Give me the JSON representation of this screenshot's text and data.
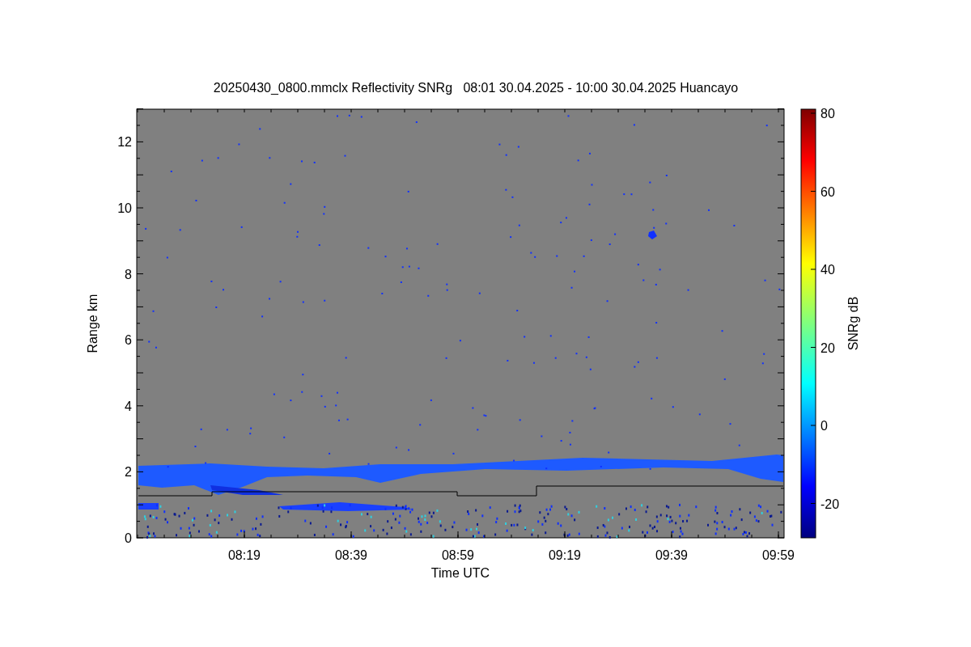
{
  "title": "20250430_0800.mmclx Reflectivity SNRg   08:01 30.04.2025 - 10:00 30.04.2025 Huancayo",
  "plot": {
    "xlabel": "Time UTC",
    "ylabel": "Range km",
    "xticks": [
      "08:19",
      "08:39",
      "08:59",
      "09:19",
      "09:39",
      "09:59"
    ],
    "yticks": [
      "12",
      "10",
      "8",
      "6",
      "4",
      "2",
      "0"
    ]
  },
  "colorbar": {
    "label": "SNRg dB",
    "ticks": [
      "80",
      "60",
      "40",
      "20",
      "0",
      "-20"
    ]
  }
}
